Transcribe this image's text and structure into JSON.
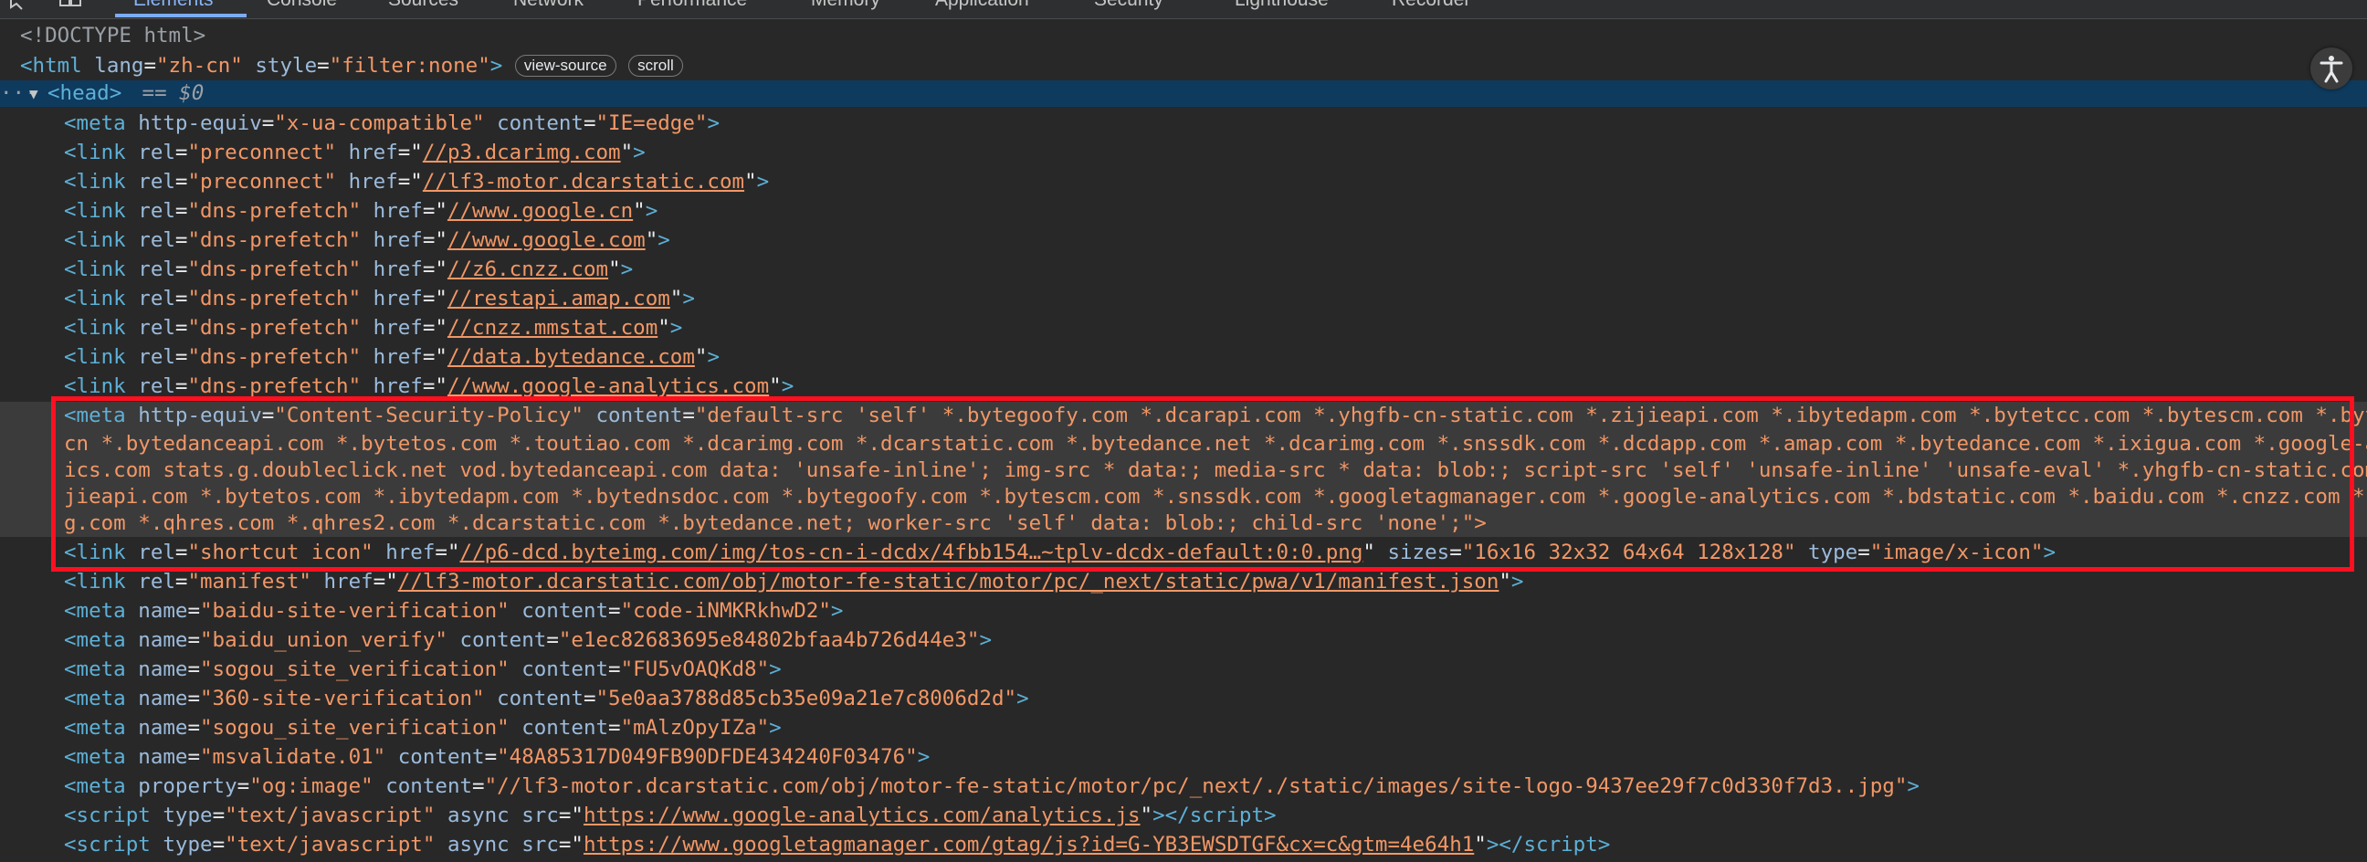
{
  "tabs": [
    "Elements",
    "Console",
    "Sources",
    "Network",
    "Performance",
    "Memory",
    "Application",
    "Security",
    "Lighthouse",
    "Recorder"
  ],
  "doctype": "<!DOCTYPE html>",
  "html_line": {
    "open": "<html ",
    "lang_attr": "lang",
    "lang_val": "\"zh-cn\"",
    "style_attr": "style",
    "style_val": "\"filter:none\"",
    "close": ">",
    "badge_view_source": "view-source",
    "badge_scroll": "scroll"
  },
  "head_line": {
    "dots": "···",
    "tag": "<head>",
    "marker": " == $0"
  },
  "csp_lines": [
    "cn *.bytedanceapi.com *.bytetos.com *.toutiao.com *.dcarimg.com *.dcarstatic.com *.bytedance.net *.dcarimg.com *.snssdk.com *.dcdapp.com *.amap.com *.bytedance.com *.ixigua.com *.google-analyt",
    "ics.com stats.g.doubleclick.net vod.bytedanceapi.com data: 'unsafe-inline'; img-src * data:; media-src * data: blob:; script-src 'self' 'unsafe-inline' 'unsafe-eval' *.yhgfb-cn-static.com *.zi",
    "jieapi.com *.bytetos.com *.ibytedapm.com *.bytednsdoc.com *.bytegoofy.com *.bytescm.com *.snssdk.com *.googletagmanager.com *.google-analytics.com *.bdstatic.com *.baidu.com *.cnzz.com *.qhim",
    "g.com *.qhres.com *.qhres2.com *.dcarstatic.com *.bytedance.net; worker-src 'self' data: blob:; child-src 'none';\">"
  ],
  "csp_first": {
    "attr1": "http-equiv",
    "val1": "\"Content-Security-Policy\"",
    "attr2": "content",
    "val2": "\"default-src 'self' *.bytegoofy.com *.dcarapi.com *.yhgfb-cn-static.com *.zijieapi.com *.ibytedapm.com *.bytetcc.com *.bytescm.com *.bytecdn."
  },
  "nodes": [
    {
      "tag": "meta",
      "a1": "http-equiv",
      "v1": "\"x-ua-compatible\"",
      "a2": "content",
      "v2": "\"IE=edge\"",
      "link": false
    },
    {
      "tag": "link",
      "a1": "rel",
      "v1": "\"preconnect\"",
      "a2": "href",
      "v2": "//p3.dcarimg.com",
      "link": true
    },
    {
      "tag": "link",
      "a1": "rel",
      "v1": "\"preconnect\"",
      "a2": "href",
      "v2": "//lf3-motor.dcarstatic.com",
      "link": true
    },
    {
      "tag": "link",
      "a1": "rel",
      "v1": "\"dns-prefetch\"",
      "a2": "href",
      "v2": "//www.google.cn",
      "link": true
    },
    {
      "tag": "link",
      "a1": "rel",
      "v1": "\"dns-prefetch\"",
      "a2": "href",
      "v2": "//www.google.com",
      "link": true
    },
    {
      "tag": "link",
      "a1": "rel",
      "v1": "\"dns-prefetch\"",
      "a2": "href",
      "v2": "//z6.cnzz.com",
      "link": true
    },
    {
      "tag": "link",
      "a1": "rel",
      "v1": "\"dns-prefetch\"",
      "a2": "href",
      "v2": "//restapi.amap.com",
      "link": true
    },
    {
      "tag": "link",
      "a1": "rel",
      "v1": "\"dns-prefetch\"",
      "a2": "href",
      "v2": "//cnzz.mmstat.com",
      "link": true
    },
    {
      "tag": "link",
      "a1": "rel",
      "v1": "\"dns-prefetch\"",
      "a2": "href",
      "v2": "//data.bytedance.com",
      "link": true
    },
    {
      "tag": "link",
      "a1": "rel",
      "v1": "\"dns-prefetch\"",
      "a2": "href",
      "v2": "//www.google-analytics.com",
      "link": true
    }
  ],
  "shortcut_icon": {
    "a1": "rel",
    "v1": "\"shortcut icon\"",
    "a2": "href",
    "v2": "//p6-dcd.byteimg.com/img/tos-cn-i-dcdx/4fbb154…~tplv-dcdx-default:0:0.png",
    "a3": "sizes",
    "v3": "\"16x16 32x32 64x64 128x128\"",
    "a4": "type",
    "v4": "\"image/x-icon\""
  },
  "manifest": {
    "a1": "rel",
    "v1": "\"manifest\"",
    "a2": "href",
    "v2": "//lf3-motor.dcarstatic.com/obj/motor-fe-static/motor/pc/_next/static/pwa/v1/manifest.json"
  },
  "metas": [
    {
      "v1": "\"baidu-site-verification\"",
      "v2": "\"code-iNMKRkhwD2\""
    },
    {
      "v1": "\"baidu_union_verify\"",
      "v2": "\"e1ec82683695e84802bfaa4b726d44e3\""
    },
    {
      "v1": "\"sogou_site_verification\"",
      "v2": "\"FU5vOAQKd8\""
    },
    {
      "v1": "\"360-site-verification\"",
      "v2": "\"5e0aa3788d85cb35e09a21e7c8006d2d\""
    },
    {
      "v1": "\"sogou_site_verification\"",
      "v2": "\"mAlzOpyIZa\""
    },
    {
      "v1": "\"msvalidate.01\"",
      "v2": "\"48A85317D049FB90DFDE434240F03476\""
    }
  ],
  "og_image": {
    "a1": "property",
    "v1": "\"og:image\"",
    "a2": "content",
    "v2": "\"//lf3-motor.dcarstatic.com/obj/motor-fe-static/motor/pc/_next/./static/images/site-logo-9437ee29f7c0d330f7d3..jpg\""
  },
  "scripts": [
    {
      "v1": "\"text/javascript\"",
      "kw": "async",
      "src": "https://www.google-analytics.com/analytics.js"
    },
    {
      "v1": "\"text/javascript\"",
      "kw": "async",
      "src": "https://www.googletagmanager.com/gtag/js?id=G-YB3EWSDTGF&cx=c&gtm=4e64h1"
    }
  ]
}
